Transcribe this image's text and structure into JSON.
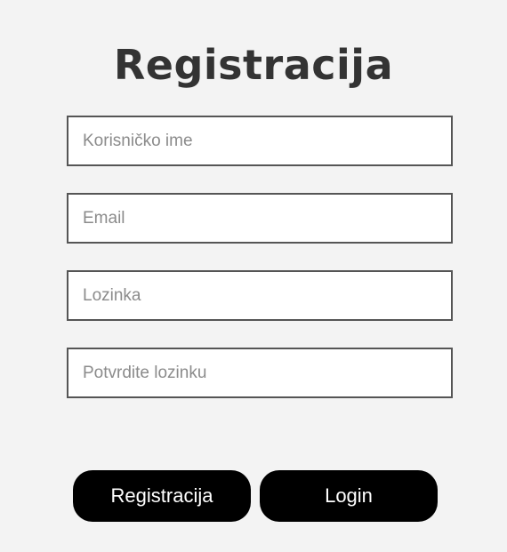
{
  "page": {
    "title": "Registracija"
  },
  "form": {
    "username": {
      "value": "",
      "placeholder": "Korisničko ime"
    },
    "email": {
      "value": "",
      "placeholder": "Email"
    },
    "password": {
      "value": "",
      "placeholder": "Lozinka"
    },
    "confirm_password": {
      "value": "",
      "placeholder": "Potvrdite lozinku"
    }
  },
  "buttons": {
    "register_label": "Registracija",
    "login_label": "Login"
  },
  "colors": {
    "background": "#f3f3f3",
    "title": "#333333",
    "field_border": "#555555",
    "button_bg": "#000000",
    "button_text": "#ffffff"
  }
}
